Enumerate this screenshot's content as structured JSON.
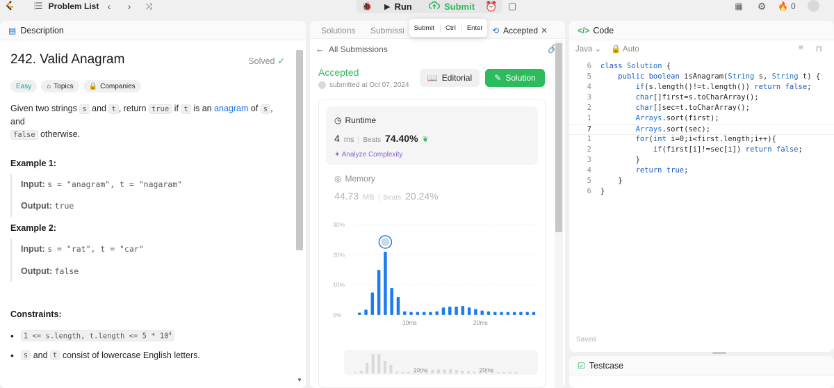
{
  "topbar": {
    "problem_list": "Problem List",
    "run": "Run",
    "submit": "Submit",
    "streak_count": "0"
  },
  "tooltip": {
    "label": "Submit",
    "key1": "Ctrl",
    "key2": "Enter"
  },
  "description": {
    "tab": "Description",
    "title": "242. Valid Anagram",
    "solved": "Solved",
    "tags": {
      "difficulty": "Easy",
      "topics": "Topics",
      "companies": "Companies"
    },
    "intro": {
      "p1": "Given two strings ",
      "s": "s",
      "and": " and ",
      "t": "t",
      "p2": ", return ",
      "true": "true",
      "if": " if ",
      "is_an": " is an ",
      "anagram": "anagram",
      "of": " of ",
      "comma_and": ", and",
      "false": "false",
      "otherwise": " otherwise."
    },
    "example1": {
      "title": "Example 1:",
      "input_label": "Input:",
      "input": "s = \"anagram\", t = \"nagaram\"",
      "output_label": "Output:",
      "output": "true"
    },
    "example2": {
      "title": "Example 2:",
      "input_label": "Input:",
      "input": "s = \"rat\", t = \"car\"",
      "output_label": "Output:",
      "output": "false"
    },
    "constraints_title": "Constraints:",
    "constraint1": "1 <= s.length, t.length <= 5 * 10",
    "constraint1_exp": "4",
    "constraint2_s": "s",
    "constraint2_and": " and ",
    "constraint2_t": "t",
    "constraint2_rest": " consist of lowercase English letters."
  },
  "submissions": {
    "tabs": {
      "solutions": "Solutions",
      "submissions": "Submissi",
      "accepted": "Accepted"
    },
    "all_submissions": "All Submissions",
    "status": "Accepted",
    "submitted": "submitted at Oct 07, 2024",
    "editorial": "Editorial",
    "solution": "Solution",
    "runtime": {
      "label": "Runtime",
      "value": "4",
      "unit": "ms",
      "beats_label": "Beats",
      "beats": "74.40%",
      "analyze": "Analyze Complexity"
    },
    "memory": {
      "label": "Memory",
      "value": "44.73",
      "unit": "MB",
      "beats_label": "Beats",
      "beats": "20.24%"
    }
  },
  "chart_data": {
    "type": "bar",
    "yticks": [
      "30%",
      "20%",
      "10%",
      "0%"
    ],
    "ylim": [
      0,
      30
    ],
    "xticks": [
      "10ms",
      "20ms"
    ],
    "values": [
      0.8,
      1.8,
      7.5,
      15,
      21,
      9,
      6,
      1.2,
      1,
      1,
      1,
      1,
      1.2,
      2.5,
      2.8,
      2.8,
      3,
      2.5,
      2,
      1.5,
      1.2,
      1,
      1,
      1,
      1,
      1,
      1,
      1
    ],
    "highlight_index": 4,
    "bar_color": "#1a7cf0",
    "brush_xticks": [
      "10ms",
      "20ms"
    ]
  },
  "code": {
    "tab": "Code",
    "language": "Java",
    "auto": "Auto",
    "saved": "Saved",
    "lines": [
      {
        "n": "6",
        "text": "class Solution {"
      },
      {
        "n": "5",
        "text": "    public boolean isAnagram(String s, String t) {"
      },
      {
        "n": "4",
        "text": "        if(s.length()!=t.length()) return false;"
      },
      {
        "n": "3",
        "text": "        char[]first=s.toCharArray();"
      },
      {
        "n": "2",
        "text": "        char[]sec=t.toCharArray();"
      },
      {
        "n": "1",
        "text": "        Arrays.sort(first);"
      },
      {
        "n": "7",
        "text": "        Arrays.sort(sec);"
      },
      {
        "n": "1",
        "text": "        for(int i=0;i<first.length;i++){"
      },
      {
        "n": "2",
        "text": "            if(first[i]!=sec[i]) return false;"
      },
      {
        "n": "3",
        "text": "        }"
      },
      {
        "n": "4",
        "text": "        return true;"
      },
      {
        "n": "5",
        "text": "    }"
      },
      {
        "n": "6",
        "text": "}"
      }
    ],
    "active_index": 6
  },
  "testcase": {
    "tab": "Testcase"
  },
  "colors": {
    "accent_green": "#2cbb5d",
    "link_blue": "#1a73e8",
    "easy": "#00af9b",
    "bar_blue": "#1a7cf0"
  }
}
